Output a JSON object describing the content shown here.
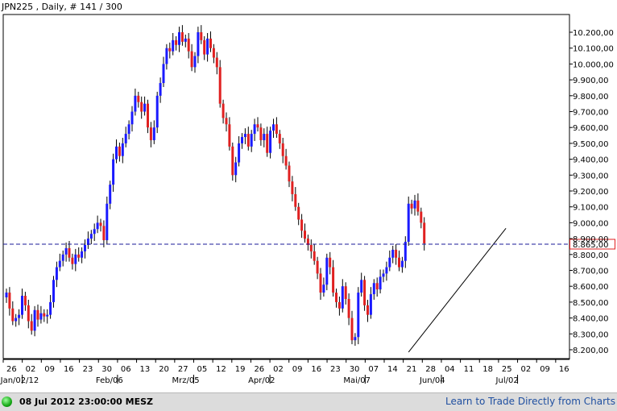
{
  "chart_data": {
    "type": "candlestick",
    "title": "JPN225 , Daily, # 141 / 300",
    "ylim": [
      8150,
      10300
    ],
    "y_ticks": [
      8200,
      8300,
      8400,
      8500,
      8600,
      8700,
      8800,
      8900,
      9000,
      9100,
      9200,
      9300,
      9400,
      9500,
      9600,
      9700,
      9800,
      9900,
      10000,
      10100,
      10200
    ],
    "y_tick_labels": [
      "8.200,00",
      "8.300,00",
      "8.400,00",
      "8.500,00",
      "8.600,00",
      "8.700,00",
      "8.800,00",
      "8.900,00",
      "9.000,00",
      "9.100,00",
      "9.200,00",
      "9.300,00",
      "9.400,00",
      "9.500,00",
      "9.600,00",
      "9.700,00",
      "9.800,00",
      "9.900,00",
      "10.000,00",
      "10.100,00",
      "10.200,00"
    ],
    "x_tick_labels": [
      "26",
      "02",
      "09",
      "16",
      "23",
      "30",
      "06",
      "13",
      "20",
      "27",
      "05",
      "12",
      "19",
      "26",
      "02",
      "09",
      "16",
      "23",
      "30",
      "07",
      "14",
      "21",
      "28",
      "04",
      "11",
      "18",
      "25",
      "02",
      "09",
      "16"
    ],
    "x_period_labels": [
      {
        "label": "Jan/02/12",
        "tick_index": 1
      },
      {
        "label": "Feb/06",
        "tick_index": 6
      },
      {
        "label": "Mrz/05",
        "tick_index": 10
      },
      {
        "label": "Apr/02",
        "tick_index": 14
      },
      {
        "label": "Mai/07",
        "tick_index": 19
      },
      {
        "label": "Jun/04",
        "tick_index": 23
      },
      {
        "label": "Jul/02",
        "tick_index": 27
      }
    ],
    "current_price": 8865,
    "current_price_label": "8.865,00",
    "colors": {
      "up": "#1a1aff",
      "down": "#e02020",
      "current_line": "#1a1a99",
      "current_box": "#e02020",
      "grid": "none"
    },
    "trendline": {
      "start_index": 128,
      "start_price": 8185,
      "end_index": 159,
      "end_price": 8965
    },
    "closes": [
      8560,
      8460,
      8380,
      8400,
      8420,
      8540,
      8480,
      8380,
      8320,
      8450,
      8390,
      8430,
      8410,
      8420,
      8500,
      8640,
      8720,
      8760,
      8800,
      8840,
      8780,
      8740,
      8800,
      8780,
      8820,
      8860,
      8900,
      8930,
      8960,
      9000,
      8980,
      8890,
      9120,
      9240,
      9400,
      9480,
      9420,
      9500,
      9560,
      9620,
      9700,
      9800,
      9760,
      9700,
      9750,
      9600,
      9520,
      9600,
      9800,
      9880,
      10000,
      10100,
      10080,
      10150,
      10120,
      10200,
      10140,
      10160,
      10080,
      9980,
      10050,
      10200,
      10150,
      10060,
      10160,
      10100,
      10040,
      9980,
      9750,
      9660,
      9620,
      9480,
      9300,
      9380,
      9500,
      9540,
      9560,
      9480,
      9560,
      9620,
      9600,
      9520,
      9560,
      9440,
      9580,
      9620,
      9560,
      9500,
      9420,
      9360,
      9260,
      9180,
      9100,
      9020,
      8950,
      8900,
      8860,
      8820,
      8760,
      8680,
      8560,
      8610,
      8780,
      8720,
      8560,
      8500,
      8460,
      8600,
      8520,
      8400,
      8260,
      8280,
      8560,
      8640,
      8480,
      8420,
      8550,
      8620,
      8580,
      8660,
      8680,
      8720,
      8780,
      8830,
      8780,
      8720,
      8760,
      8880,
      9120,
      9090,
      9140,
      9070,
      9000,
      8870
    ],
    "status_text": "08 Jul 2012 23:00:00 MESZ",
    "link_text": "Learn to Trade Directly from Charts"
  }
}
